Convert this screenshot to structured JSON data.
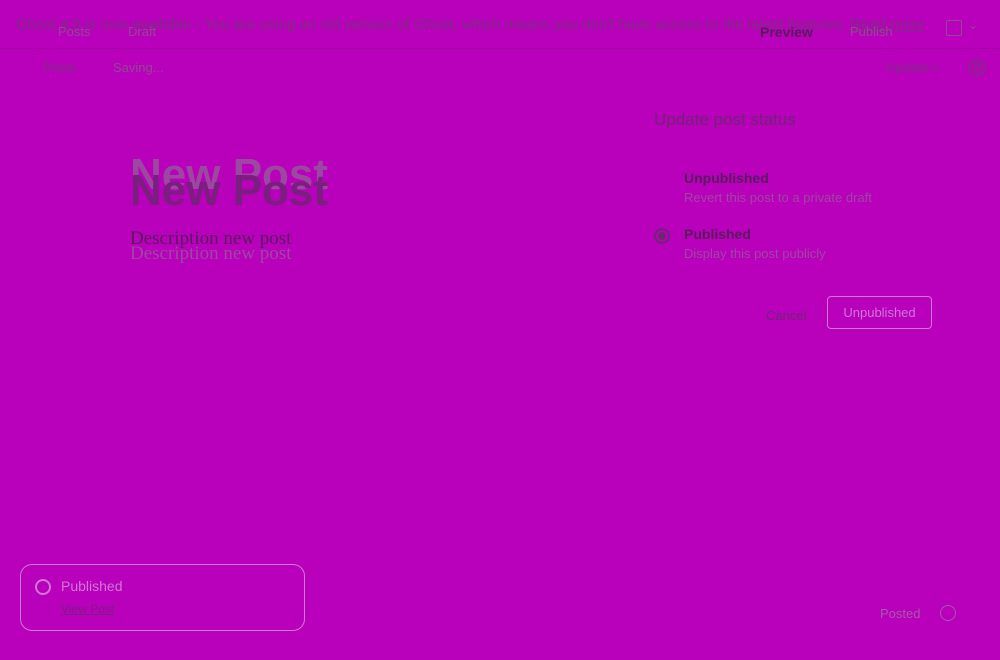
{
  "banner": {
    "message": "Ghost 4.0 is now available - You are using an old version of Ghost, which means you don't have access to the latest features.",
    "link_label": "Read more",
    "ghost_posts": "Posts",
    "ghost_draft": "Draft",
    "preview_label": "Preview",
    "publish_label": "Publish"
  },
  "toolbar": {
    "posts_label": "Posts",
    "saving_label": "Saving...",
    "update_label": "Update"
  },
  "editor": {
    "title": "New Post",
    "description": "Description new post"
  },
  "status_panel": {
    "title": "Update post status",
    "options": [
      {
        "label": "Unpublished",
        "sub": "Revert this post to a private draft",
        "selected": false
      },
      {
        "label": "Published",
        "sub": "Display this post publicly",
        "selected": true
      }
    ],
    "cancel_label": "Cancel",
    "confirm_label": "Unpublished"
  },
  "toast": {
    "message": "Published",
    "link_label": "View Post"
  },
  "footer": {
    "label": "Posted"
  },
  "colors": {
    "background": "#b900bb",
    "accent": "#cf76d6"
  }
}
